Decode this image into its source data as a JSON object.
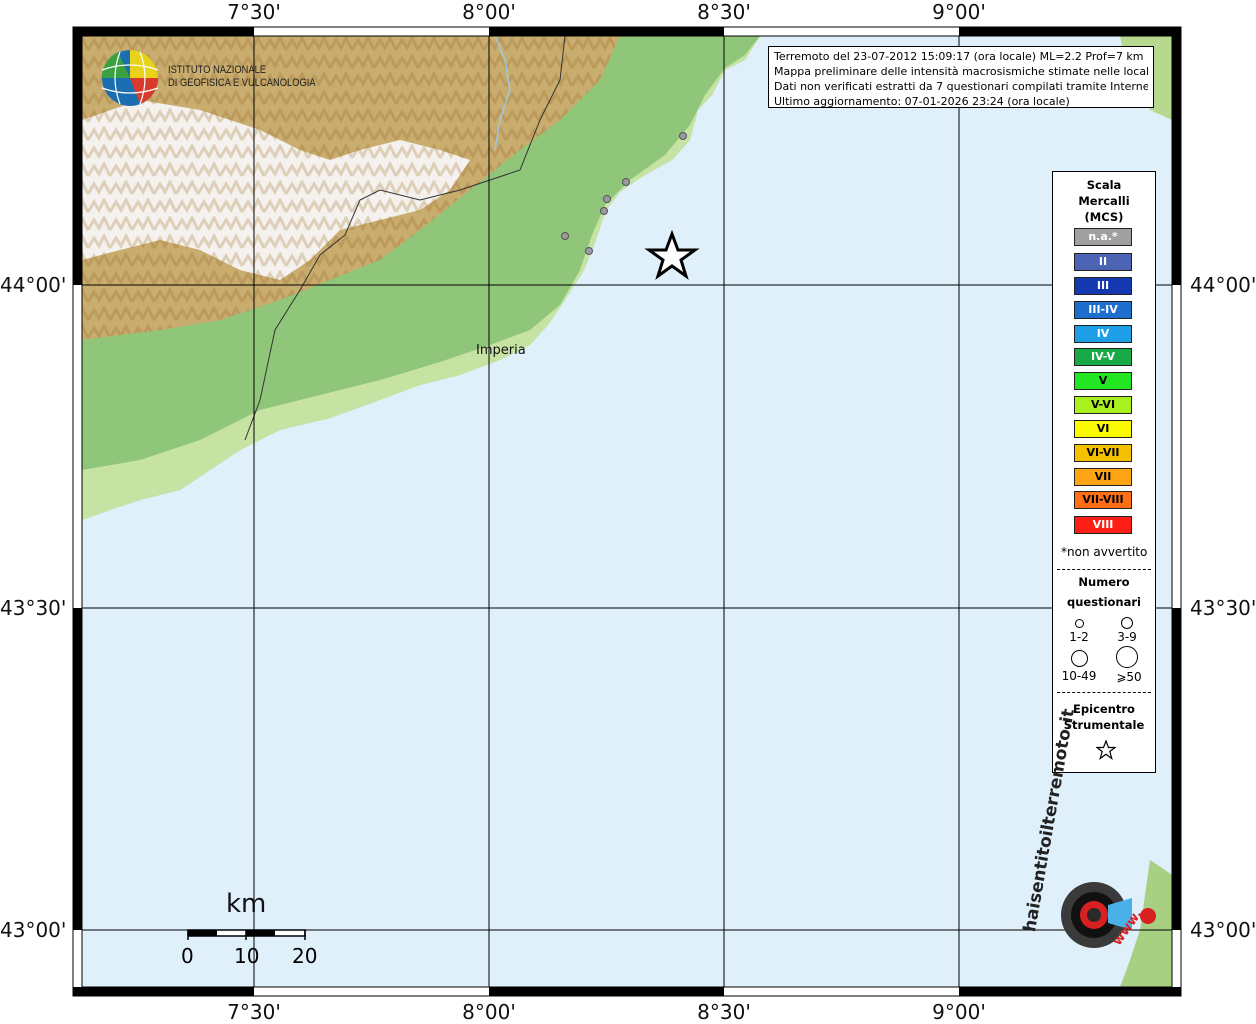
{
  "map": {
    "lon_labels": [
      "7°30'",
      "8°00'",
      "8°30'",
      "9°00'"
    ],
    "lat_labels": [
      "44°00'",
      "43°30'",
      "43°00'"
    ],
    "place_label": "Imperia",
    "scale": {
      "unit": "km",
      "ticks": [
        "0",
        "10",
        "20"
      ]
    },
    "epicenter_symbol": "star-icon"
  },
  "logo_ingv": {
    "line1": "ISTITUTO NAZIONALE",
    "line2": "DI GEOFISICA E VULCANOLOGIA"
  },
  "info_box": {
    "line1": "Terremoto del 23-07-2012 15:09:17 (ora locale) ML=2.2 Prof=7 km",
    "line2": "Mappa preliminare delle intensità macrosismiche stimate nelle località",
    "line3": "Dati non verificati estratti da 7 questionari compilati tramite Internet.",
    "line4": "Ultimo aggiornamento: 07-01-2026 23:24 (ora locale)"
  },
  "legend": {
    "title1": "Scala",
    "title2": "Mercalli",
    "title3": "(MCS)",
    "levels": [
      {
        "label": "n.a.*",
        "color": "#a0a0a0"
      },
      {
        "label": "II",
        "color": "#4c64b4"
      },
      {
        "label": "III",
        "color": "#1438b0"
      },
      {
        "label": "III-IV",
        "color": "#1e6ed0"
      },
      {
        "label": "IV",
        "color": "#1e9ee6"
      },
      {
        "label": "IV-V",
        "color": "#18aa46"
      },
      {
        "label": "V",
        "color": "#22e622"
      },
      {
        "label": "V-VI",
        "color": "#aaf01e"
      },
      {
        "label": "VI",
        "color": "#fafa00"
      },
      {
        "label": "VI-VII",
        "color": "#f4c000"
      },
      {
        "label": "VII",
        "color": "#ffa414"
      },
      {
        "label": "VII-VIII",
        "color": "#ff6e14"
      },
      {
        "label": "VIII",
        "color": "#ff1e14"
      }
    ],
    "not_felt_note": "*non avvertito",
    "count_title1": "Numero",
    "count_title2": "questionari",
    "count_labels": [
      "1-2",
      "3-9",
      "10-49",
      "⩾50"
    ],
    "epicenter_title1": "Epicentro",
    "epicenter_title2": "Strumentale"
  },
  "logo_hsit": {
    "text": "haisentitoilterremoto.it",
    "www": "www."
  },
  "colors": {
    "sea": "#dff0fb",
    "grid": "#000000",
    "frame": "#000000"
  }
}
